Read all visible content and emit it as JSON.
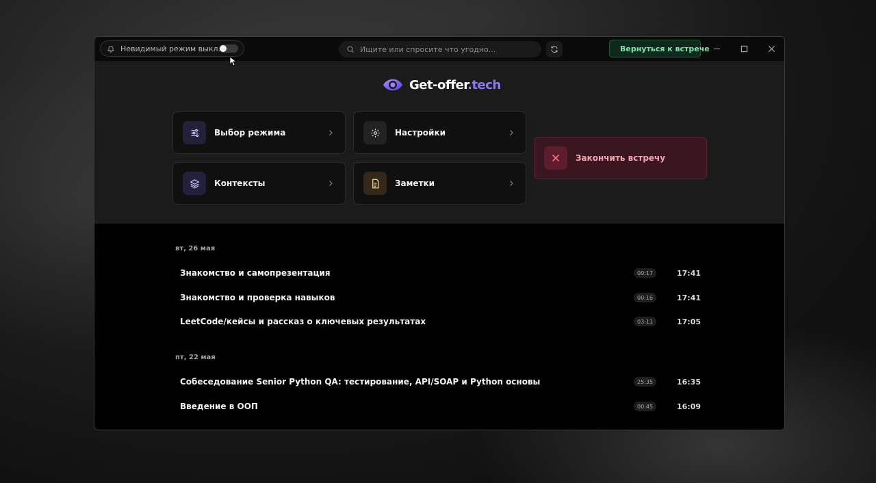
{
  "titlebar": {
    "stealth_label": "Невидимый режим выкл...",
    "stealth_on": false,
    "search_placeholder": "Ищите или спросите что угодно...",
    "back_label": "Вернуться к встрече"
  },
  "logo": {
    "name": "Get-offer",
    "tld": ".tech"
  },
  "cards": {
    "mode": "Выбор режима",
    "settings": "Настройки",
    "contexts": "Контексты",
    "notes": "Заметки"
  },
  "end_meeting": "Закончить встречу",
  "history": [
    {
      "date": "вт, 26 мая",
      "items": [
        {
          "title": "Знакомство и самопрезентация",
          "duration": "00:17",
          "time": "17:41"
        },
        {
          "title": "Знакомство и проверка навыков",
          "duration": "00:16",
          "time": "17:41"
        },
        {
          "title": "LeetCode/кейсы и рассказ о ключевых результатах",
          "duration": "03:11",
          "time": "17:05"
        }
      ]
    },
    {
      "date": "пт, 22 мая",
      "items": [
        {
          "title": "Собеседование Senior Python QA: тестирование, API/SOAP и Python основы",
          "duration": "25:35",
          "time": "16:35"
        },
        {
          "title": "Введение в ООП",
          "duration": "00:45",
          "time": "16:09"
        }
      ]
    }
  ],
  "colors": {
    "accent": "#8b7cf6",
    "live": "#3ddc84",
    "danger": "#ff6b86"
  }
}
